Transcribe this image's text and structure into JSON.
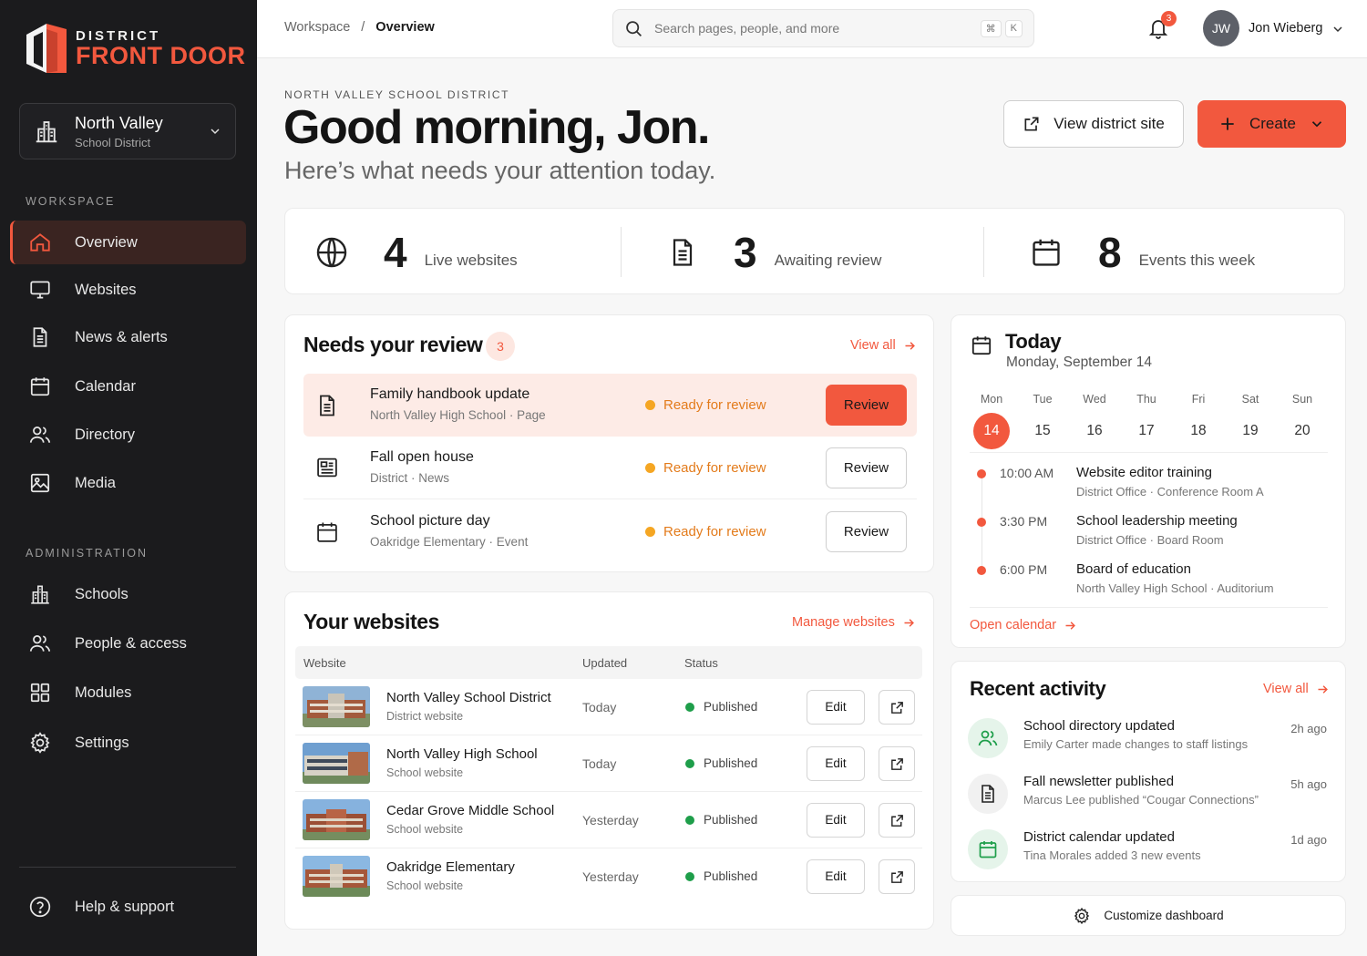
{
  "brand": {
    "top": "DISTRICT",
    "bottom": "FRONT DOOR",
    "accent": "#f2583e"
  },
  "district_selector": {
    "name": "North Valley",
    "sub": "School District"
  },
  "sidebar": {
    "workspace_title": "WORKSPACE",
    "workspace_items": [
      {
        "label": "Overview",
        "icon": "home-icon",
        "active": true
      },
      {
        "label": "Websites",
        "icon": "monitor-icon"
      },
      {
        "label": "News & alerts",
        "icon": "document-icon"
      },
      {
        "label": "Calendar",
        "icon": "calendar-icon"
      },
      {
        "label": "Directory",
        "icon": "people-icon"
      },
      {
        "label": "Media",
        "icon": "image-icon"
      }
    ],
    "admin_title": "ADMINISTRATION",
    "admin_items": [
      {
        "label": "Schools",
        "icon": "building-icon"
      },
      {
        "label": "People & access",
        "icon": "people-icon"
      },
      {
        "label": "Modules",
        "icon": "grid-icon"
      },
      {
        "label": "Settings",
        "icon": "gear-icon"
      }
    ],
    "help": {
      "label": "Help & support",
      "icon": "help-circle-icon"
    }
  },
  "topbar": {
    "breadcrumb": [
      "Workspace",
      "/",
      "Overview"
    ],
    "search_placeholder": "Search pages, people, and more",
    "shortcut": [
      "⌘",
      "K"
    ],
    "notifications": "3",
    "user_initials": "JW",
    "user_name": "Jon Wieberg"
  },
  "header": {
    "eyebrow": "NORTH VALLEY SCHOOL DISTRICT",
    "greeting": "Good morning, Jon.",
    "subtitle": "Here’s what needs your attention today.",
    "view_site": "View district site",
    "create": "Create"
  },
  "stats": [
    {
      "value": "4",
      "label": "Live websites",
      "icon": "globe-icon"
    },
    {
      "value": "3",
      "label": "Awaiting review",
      "icon": "document-icon"
    },
    {
      "value": "8",
      "label": "Events this week",
      "icon": "calendar-icon"
    }
  ],
  "review": {
    "title": "Needs your review",
    "count": "3",
    "view_all": "View all",
    "items": [
      {
        "title": "Family handbook update",
        "sub": "North Valley High School · Page",
        "status": "Ready for review",
        "action": "Review",
        "icon": "document-icon"
      },
      {
        "title": "Fall open house",
        "sub": "District · News",
        "status": "Ready for review",
        "action": "Review",
        "icon": "newspaper-icon"
      },
      {
        "title": "School picture day",
        "sub": "Oakridge Elementary · Event",
        "status": "Ready for review",
        "action": "Review",
        "icon": "calendar-icon"
      }
    ]
  },
  "websites": {
    "title": "Your websites",
    "manage": "Manage websites",
    "columns": [
      "Website",
      "Updated",
      "Status"
    ],
    "rows": [
      {
        "name": "North Valley School District",
        "type": "District website",
        "updated": "Today",
        "status": "Published",
        "edit": "Edit"
      },
      {
        "name": "North Valley High School",
        "type": "School website",
        "updated": "Today",
        "status": "Published",
        "edit": "Edit"
      },
      {
        "name": "Cedar Grove Middle School",
        "type": "School website",
        "updated": "Yesterday",
        "status": "Published",
        "edit": "Edit"
      },
      {
        "name": "Oakridge Elementary",
        "type": "School website",
        "updated": "Yesterday",
        "status": "Published",
        "edit": "Edit"
      }
    ]
  },
  "today": {
    "title": "Today",
    "date": "Monday, September 14",
    "days": [
      {
        "name": "Mon",
        "num": "14",
        "today": true
      },
      {
        "name": "Tue",
        "num": "15"
      },
      {
        "name": "Wed",
        "num": "16"
      },
      {
        "name": "Thu",
        "num": "17"
      },
      {
        "name": "Fri",
        "num": "18"
      },
      {
        "name": "Sat",
        "num": "19"
      },
      {
        "name": "Sun",
        "num": "20"
      }
    ],
    "events": [
      {
        "time": "10:00 AM",
        "title": "Website editor training",
        "location": "District Office · Conference Room A"
      },
      {
        "time": "3:30 PM",
        "title": "School leadership meeting",
        "location": "District Office · Board Room"
      },
      {
        "time": "6:00 PM",
        "title": "Board of education",
        "location": "North Valley High School · Auditorium"
      }
    ],
    "open_calendar": "Open calendar"
  },
  "activity": {
    "title": "Recent activity",
    "view_all": "View all",
    "items": [
      {
        "title": "School directory updated",
        "sub": "Emily Carter made changes to staff listings",
        "time": "2h ago",
        "icon": "people-icon"
      },
      {
        "title": "Fall newsletter published",
        "sub": "Marcus Lee published “Cougar Connections”",
        "time": "5h ago",
        "icon": "document-icon"
      },
      {
        "title": "District calendar updated",
        "sub": "Tina Morales added 3 new events",
        "time": "1d ago",
        "icon": "calendar-icon"
      }
    ]
  },
  "customize": "Customize dashboard",
  "colors": {
    "accent": "#f2583e",
    "warning": "#f5a623",
    "success": "#1e9e4a",
    "sidebar_bg": "#1b1b1d"
  }
}
